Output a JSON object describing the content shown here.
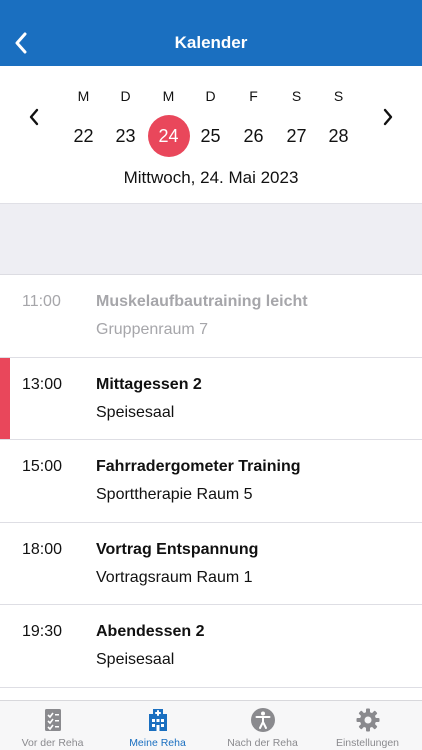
{
  "header": {
    "title": "Kalender",
    "back_icon": "chevron-left-icon"
  },
  "week": {
    "days": [
      {
        "dow": "M",
        "num": "22"
      },
      {
        "dow": "D",
        "num": "23"
      },
      {
        "dow": "M",
        "num": "24"
      },
      {
        "dow": "D",
        "num": "25"
      },
      {
        "dow": "F",
        "num": "26"
      },
      {
        "dow": "S",
        "num": "27"
      },
      {
        "dow": "S",
        "num": "28"
      }
    ],
    "selected_date": "Mittwoch, 24. Mai 2023",
    "accent_color": "#e9475b"
  },
  "events": [
    {
      "time": "11:00",
      "title": "Muskelaufbautraining leicht",
      "location": "Gruppenraum 7"
    },
    {
      "time": "13:00",
      "title": "Mittagessen 2",
      "location": "Speisesaal"
    },
    {
      "time": "15:00",
      "title": "Fahrradergometer Training",
      "location": "Sporttherapie Raum 5"
    },
    {
      "time": "18:00",
      "title": "Vortrag Entspannung",
      "location": "Vortragsraum Raum 1"
    },
    {
      "time": "19:30",
      "title": "Abendessen 2",
      "location": "Speisesaal"
    }
  ],
  "tabs": [
    {
      "label": "Vor der Reha",
      "icon": "checklist-icon"
    },
    {
      "label": "Meine Reha",
      "icon": "hospital-icon"
    },
    {
      "label": "Nach der Reha",
      "icon": "accessibility-icon"
    },
    {
      "label": "Einstellungen",
      "icon": "gear-icon"
    }
  ],
  "colors": {
    "brand": "#1a6fc0",
    "active_tab": "#1a6fc0",
    "inactive_tab": "#8a8a8e"
  }
}
